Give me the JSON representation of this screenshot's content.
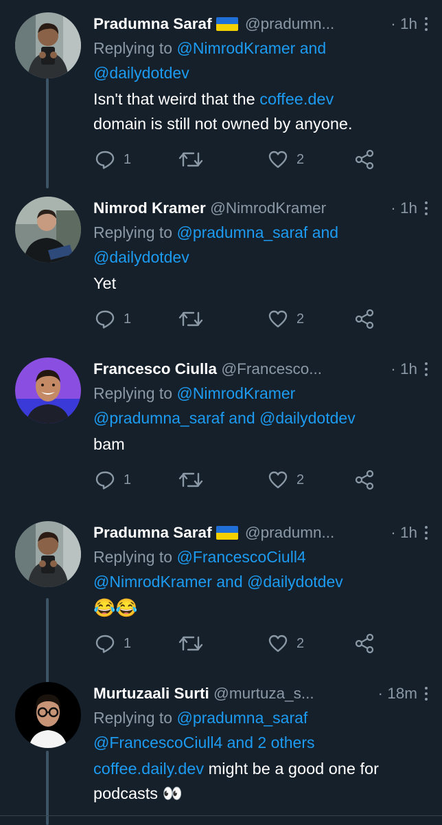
{
  "colors": {
    "background": "#15202b",
    "text": "#ffffff",
    "muted": "#8b98a5",
    "link": "#1d9bf0",
    "divider": "#38444d",
    "thread_line": "#3d5466"
  },
  "tweets": [
    {
      "name": "Pradumna Saraf",
      "has_flag": true,
      "flag": "ukraine-flag",
      "handle": "@pradumn...",
      "dot": "·",
      "time": "1h",
      "reply_prefix": "Replying to",
      "reply_line1": "@NimrodKramer and",
      "reply_line2": "@dailydotdev",
      "body_pre": "Isn't that weird that the",
      "body_link": "coffee.dev",
      "body_post": "domain is still not owned by anyone.",
      "replies": "1",
      "retweets": "",
      "likes": "2"
    },
    {
      "name": "Nimrod Kramer",
      "has_flag": false,
      "handle": "@NimrodKramer",
      "dot": "·",
      "time": "1h",
      "reply_prefix": "Replying to",
      "reply_line1": "@pradumna_saraf and",
      "reply_line2": "@dailydotdev",
      "body": "Yet",
      "replies": "1",
      "retweets": "",
      "likes": "2"
    },
    {
      "name": "Francesco Ciulla",
      "has_flag": false,
      "handle": "@Francesco...",
      "dot": "·",
      "time": "1h",
      "reply_prefix": "Replying to",
      "reply_line1": "@NimrodKramer",
      "reply_line2": "@pradumna_saraf and @dailydotdev",
      "body": "bam",
      "replies": "1",
      "retweets": "",
      "likes": "2"
    },
    {
      "name": "Pradumna Saraf",
      "has_flag": true,
      "flag": "ukraine-flag",
      "handle": "@pradumn...",
      "dot": "·",
      "time": "1h",
      "reply_prefix": "Replying to",
      "reply_line1": "@FrancescoCiull4",
      "reply_line2": "@NimrodKramer and @dailydotdev",
      "body": "😂😂",
      "replies": "1",
      "retweets": "",
      "likes": "2"
    },
    {
      "name": "Murtuzaali Surti",
      "has_flag": false,
      "handle": "@murtuza_s...",
      "dot": "·",
      "time": "18m",
      "reply_prefix": "Replying to",
      "reply_line1": "@pradumna_saraf",
      "reply_line2": "@FrancescoCiull4 and 2 others",
      "body_link": "coffee.daily.dev",
      "body_post": "might be a good one for",
      "body_line2": "podcasts 👀"
    }
  ]
}
